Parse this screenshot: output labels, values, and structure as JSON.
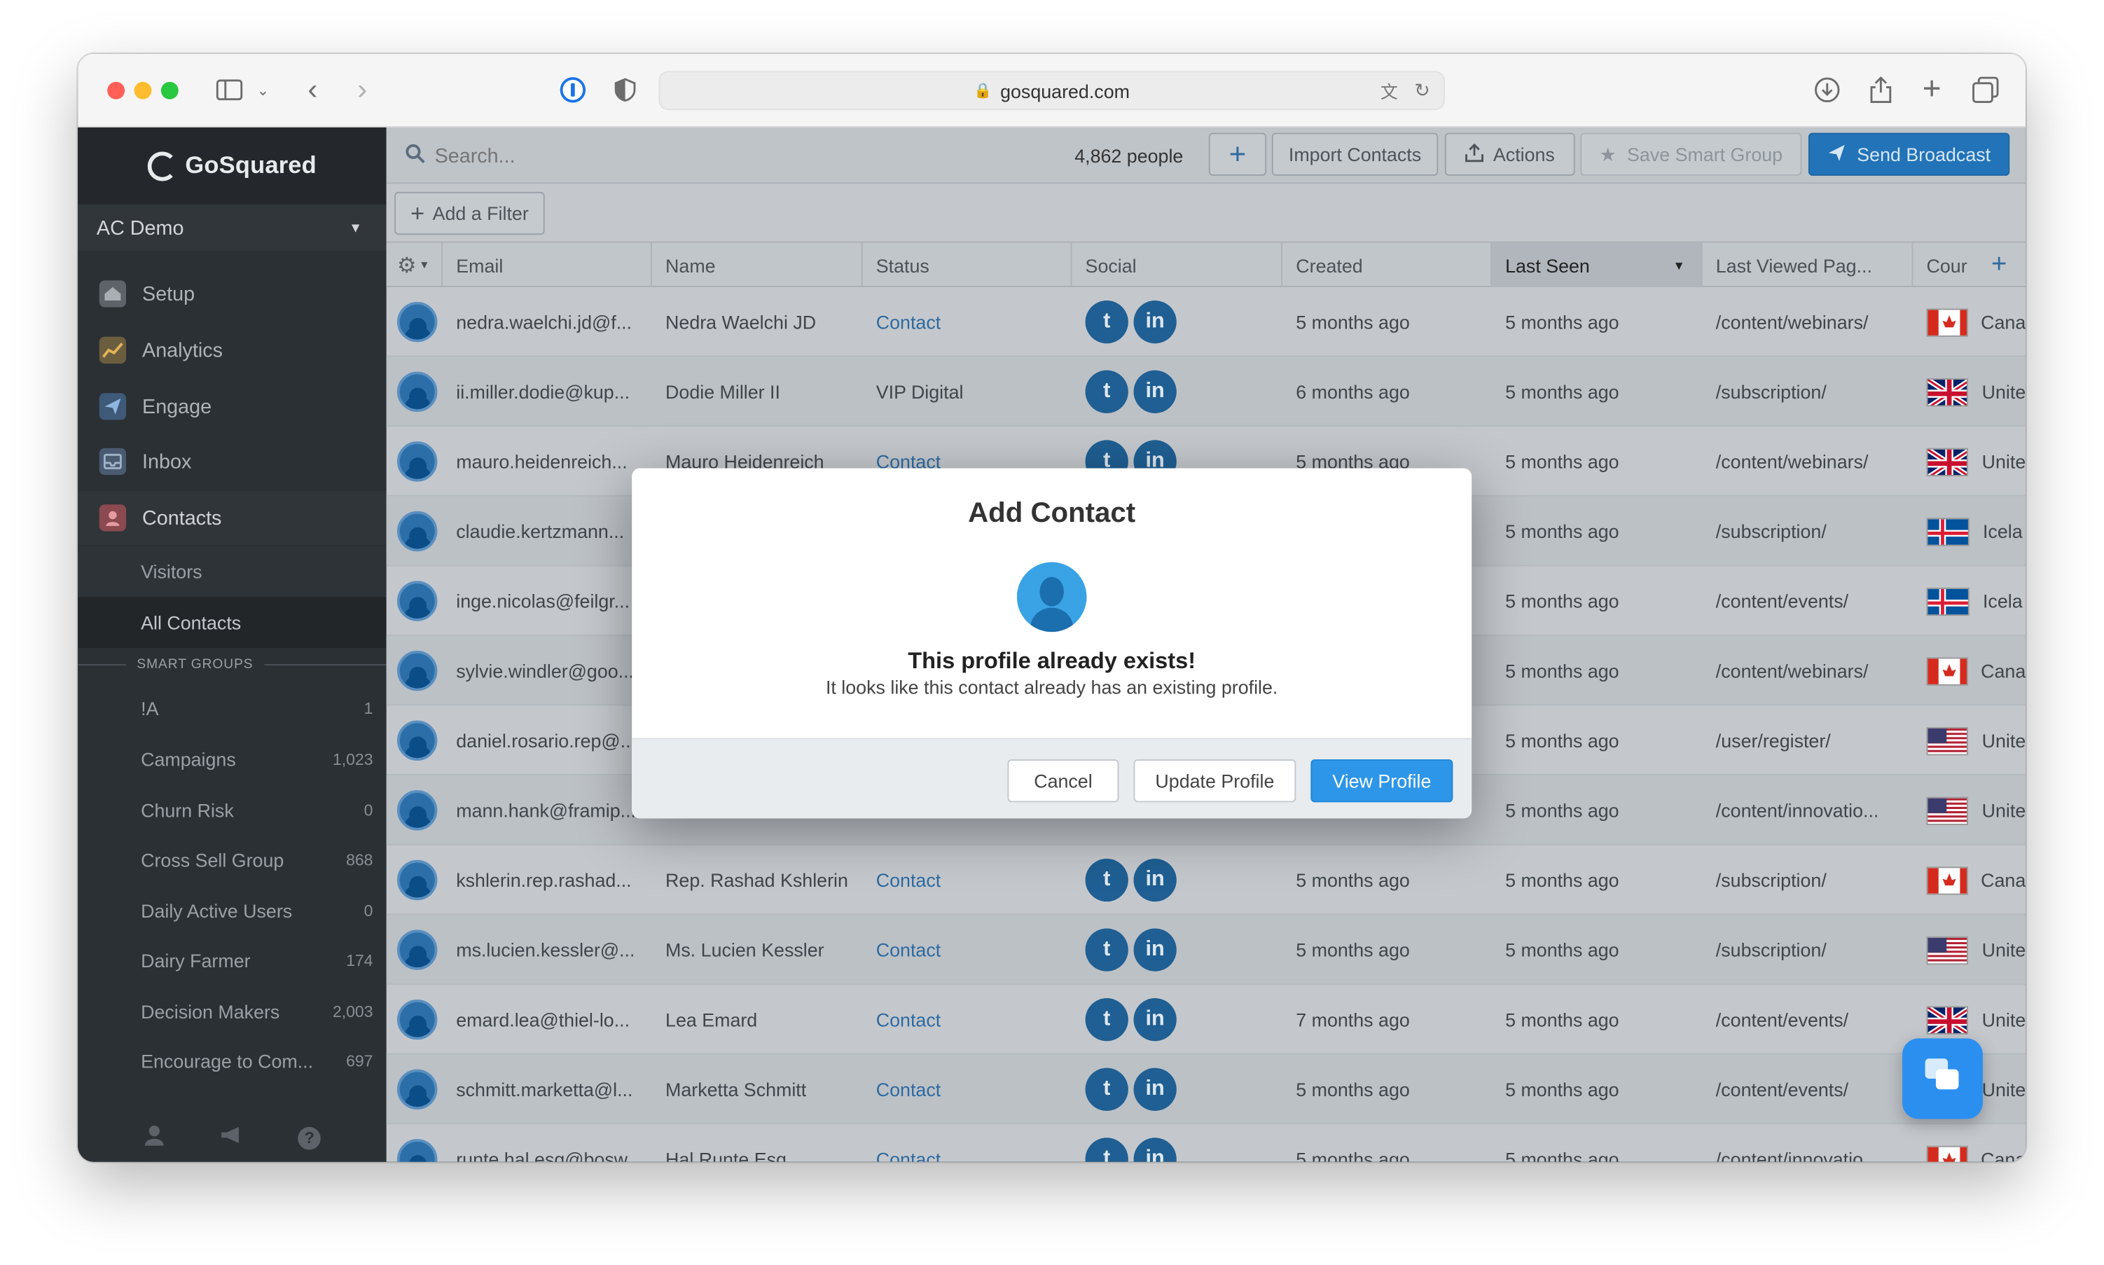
{
  "browser": {
    "url": "gosquared.com",
    "colors": {
      "close": "#ff5f57",
      "minimize": "#febc2e",
      "zoom": "#28c840"
    }
  },
  "sidebar": {
    "brand": "GoSquared",
    "account": "AC Demo",
    "nav": [
      {
        "label": "Setup",
        "icon": "home-icon"
      },
      {
        "label": "Analytics",
        "icon": "chart-icon"
      },
      {
        "label": "Engage",
        "icon": "paper-plane-icon"
      },
      {
        "label": "Inbox",
        "icon": "inbox-icon"
      },
      {
        "label": "Contacts",
        "icon": "contacts-icon"
      }
    ],
    "contacts_sub": [
      "Visitors",
      "All Contacts"
    ],
    "smart_groups_header": "SMART GROUPS",
    "smart_groups": [
      {
        "name": "!A",
        "count": "1"
      },
      {
        "name": "Campaigns",
        "count": "1,023"
      },
      {
        "name": "Churn Risk",
        "count": "0"
      },
      {
        "name": "Cross Sell Group",
        "count": "868"
      },
      {
        "name": "Daily Active Users",
        "count": "0"
      },
      {
        "name": "Dairy Farmer",
        "count": "174"
      },
      {
        "name": "Decision Makers",
        "count": "2,003"
      },
      {
        "name": "Encourage to Com...",
        "count": "697"
      }
    ]
  },
  "toolbar": {
    "search_placeholder": "Search...",
    "people_count": "4,862 people",
    "add_label": "+",
    "import_label": "Import Contacts",
    "actions_label": "Actions",
    "save_group_label": "Save Smart Group",
    "broadcast_label": "Send Broadcast",
    "add_filter_label": "Add a Filter"
  },
  "table": {
    "columns": [
      "Email",
      "Name",
      "Status",
      "Social",
      "Created",
      "Last Seen",
      "Last Viewed Pag...",
      "Cour"
    ],
    "rows": [
      {
        "email": "nedra.waelchi.jd@f...",
        "name": "Nedra Waelchi JD",
        "status": "Contact",
        "created": "5 months ago",
        "last_seen": "5 months ago",
        "page": "/content/webinars/",
        "country": "Cana",
        "flag": "ca"
      },
      {
        "email": "ii.miller.dodie@kup...",
        "name": "Dodie Miller II",
        "status": "VIP Digital",
        "created": "6 months ago",
        "last_seen": "5 months ago",
        "page": "/subscription/",
        "country": "Unite",
        "flag": "uk"
      },
      {
        "email": "mauro.heidenreich...",
        "name": "Mauro Heidenreich",
        "status": "Contact",
        "created": "5 months ago",
        "last_seen": "5 months ago",
        "page": "/content/webinars/",
        "country": "Unite",
        "flag": "uk"
      },
      {
        "email": "claudie.kertzmann...",
        "name": "",
        "status": "",
        "created": "",
        "last_seen": "5 months ago",
        "page": "/subscription/",
        "country": "Icela",
        "flag": "is"
      },
      {
        "email": "inge.nicolas@feilgr...",
        "name": "",
        "status": "",
        "created": "",
        "last_seen": "5 months ago",
        "page": "/content/events/",
        "country": "Icela",
        "flag": "is"
      },
      {
        "email": "sylvie.windler@goo...",
        "name": "",
        "status": "",
        "created": "",
        "last_seen": "5 months ago",
        "page": "/content/webinars/",
        "country": "Cana",
        "flag": "ca"
      },
      {
        "email": "daniel.rosario.rep@...",
        "name": "",
        "status": "",
        "created": "",
        "last_seen": "5 months ago",
        "page": "/user/register/",
        "country": "Unite",
        "flag": "us"
      },
      {
        "email": "mann.hank@framip...",
        "name": "",
        "status": "",
        "created": "",
        "last_seen": "5 months ago",
        "page": "/content/innovatio...",
        "country": "Unite",
        "flag": "us"
      },
      {
        "email": "kshlerin.rep.rashad...",
        "name": "Rep. Rashad Kshlerin",
        "status": "Contact",
        "created": "5 months ago",
        "last_seen": "5 months ago",
        "page": "/subscription/",
        "country": "Cana",
        "flag": "ca"
      },
      {
        "email": "ms.lucien.kessler@...",
        "name": "Ms. Lucien Kessler",
        "status": "Contact",
        "created": "5 months ago",
        "last_seen": "5 months ago",
        "page": "/subscription/",
        "country": "Unite",
        "flag": "us"
      },
      {
        "email": "emard.lea@thiel-lo...",
        "name": "Lea Emard",
        "status": "Contact",
        "created": "7 months ago",
        "last_seen": "5 months ago",
        "page": "/content/events/",
        "country": "Unite",
        "flag": "uk"
      },
      {
        "email": "schmitt.marketta@l...",
        "name": "Marketta Schmitt",
        "status": "Contact",
        "created": "5 months ago",
        "last_seen": "5 months ago",
        "page": "/content/events/",
        "country": "Unite",
        "flag": "uk"
      },
      {
        "email": "runte.hal.esq@bosw...",
        "name": "Hal Runte Esq.",
        "status": "Contact",
        "created": "5 months ago",
        "last_seen": "5 months ago",
        "page": "/content/innovatio...",
        "country": "Cana",
        "flag": "ca"
      }
    ]
  },
  "modal": {
    "title": "Add Contact",
    "heading": "This profile already exists!",
    "message": "It looks like this contact already has an existing profile.",
    "cancel_label": "Cancel",
    "update_label": "Update Profile",
    "view_label": "View Profile"
  }
}
